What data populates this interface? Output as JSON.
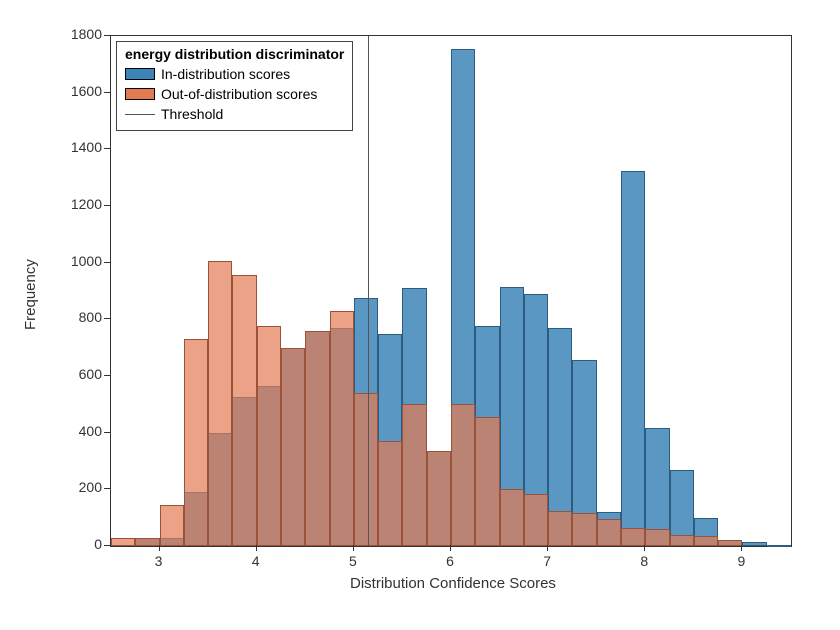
{
  "chart_data": {
    "type": "bar",
    "title": "energy distribution discriminator",
    "xlabel": "Distribution Confidence Scores",
    "ylabel": "Frequency",
    "xlim": [
      2.5,
      9.5
    ],
    "ylim": [
      0,
      1800
    ],
    "xticks": [
      3,
      4,
      5,
      6,
      7,
      8,
      9
    ],
    "yticks": [
      0,
      200,
      400,
      600,
      800,
      1000,
      1200,
      1400,
      1600,
      1800
    ],
    "bin_edges": [
      2.5,
      2.75,
      3.0,
      3.25,
      3.5,
      3.75,
      4.0,
      4.25,
      4.5,
      4.75,
      5.0,
      5.25,
      5.5,
      5.75,
      6.0,
      6.25,
      6.5,
      6.75,
      7.0,
      7.25,
      7.5,
      7.75,
      8.0,
      8.25,
      8.5,
      8.75,
      9.0,
      9.25,
      9.5
    ],
    "series": [
      {
        "name": "In-distribution scores",
        "color": "#3d85b8",
        "values": [
          0,
          30,
          30,
          190,
          400,
          525,
          565,
          700,
          760,
          770,
          875,
          750,
          910,
          335,
          1755,
          775,
          915,
          890,
          770,
          655,
          120,
          1325,
          415,
          270,
          100,
          20,
          15,
          5
        ]
      },
      {
        "name": "Out-of-distribution scores",
        "color": "#e27b53",
        "values": [
          30,
          30,
          145,
          730,
          1005,
          955,
          775,
          700,
          760,
          830,
          540,
          370,
          500,
          335,
          500,
          455,
          200,
          185,
          125,
          115,
          95,
          65,
          60,
          40,
          35,
          20,
          0,
          0
        ]
      }
    ],
    "threshold": 5.15,
    "legend": {
      "title": "energy distribution discriminator",
      "items": [
        "In-distribution scores",
        "Out-of-distribution scores",
        "Threshold"
      ],
      "position": "northwest"
    }
  }
}
